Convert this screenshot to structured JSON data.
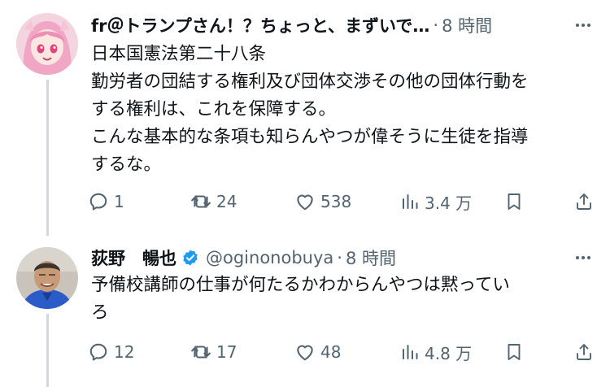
{
  "tweets": [
    {
      "display_name": "fr＠トランプさん！？ちょっと、まずいで…",
      "handle": "",
      "separator": "·",
      "time": "8 時間",
      "verified": false,
      "avatar_icon": "anime-girl-avatar",
      "body_lines": [
        "日本国憲法第二十八条",
        "勤労者の団結する権利及び団体交渉その他の団体行動を",
        "する権利は、これを保障する。",
        "こんな基本的な条項も知らんやつが偉そうに生徒を指導",
        "するな。"
      ],
      "replies": "1",
      "retweets": "24",
      "likes": "538",
      "views": "3.4 万"
    },
    {
      "display_name": "荻野　暢也",
      "handle": "@oginonobuya",
      "separator": "·",
      "time": "8 時間",
      "verified": true,
      "avatar_icon": "man-photo-avatar",
      "body_lines": [
        "予備校講師の仕事が何たるかわからんやつは黙ってい",
        "ろ"
      ],
      "replies": "12",
      "retweets": "17",
      "likes": "48",
      "views": "4.8 万"
    }
  ],
  "colors": {
    "text": "#0f1419",
    "secondary": "#536471",
    "thread_line": "#cfd9de",
    "verified_blue": "#1d9bf0"
  }
}
